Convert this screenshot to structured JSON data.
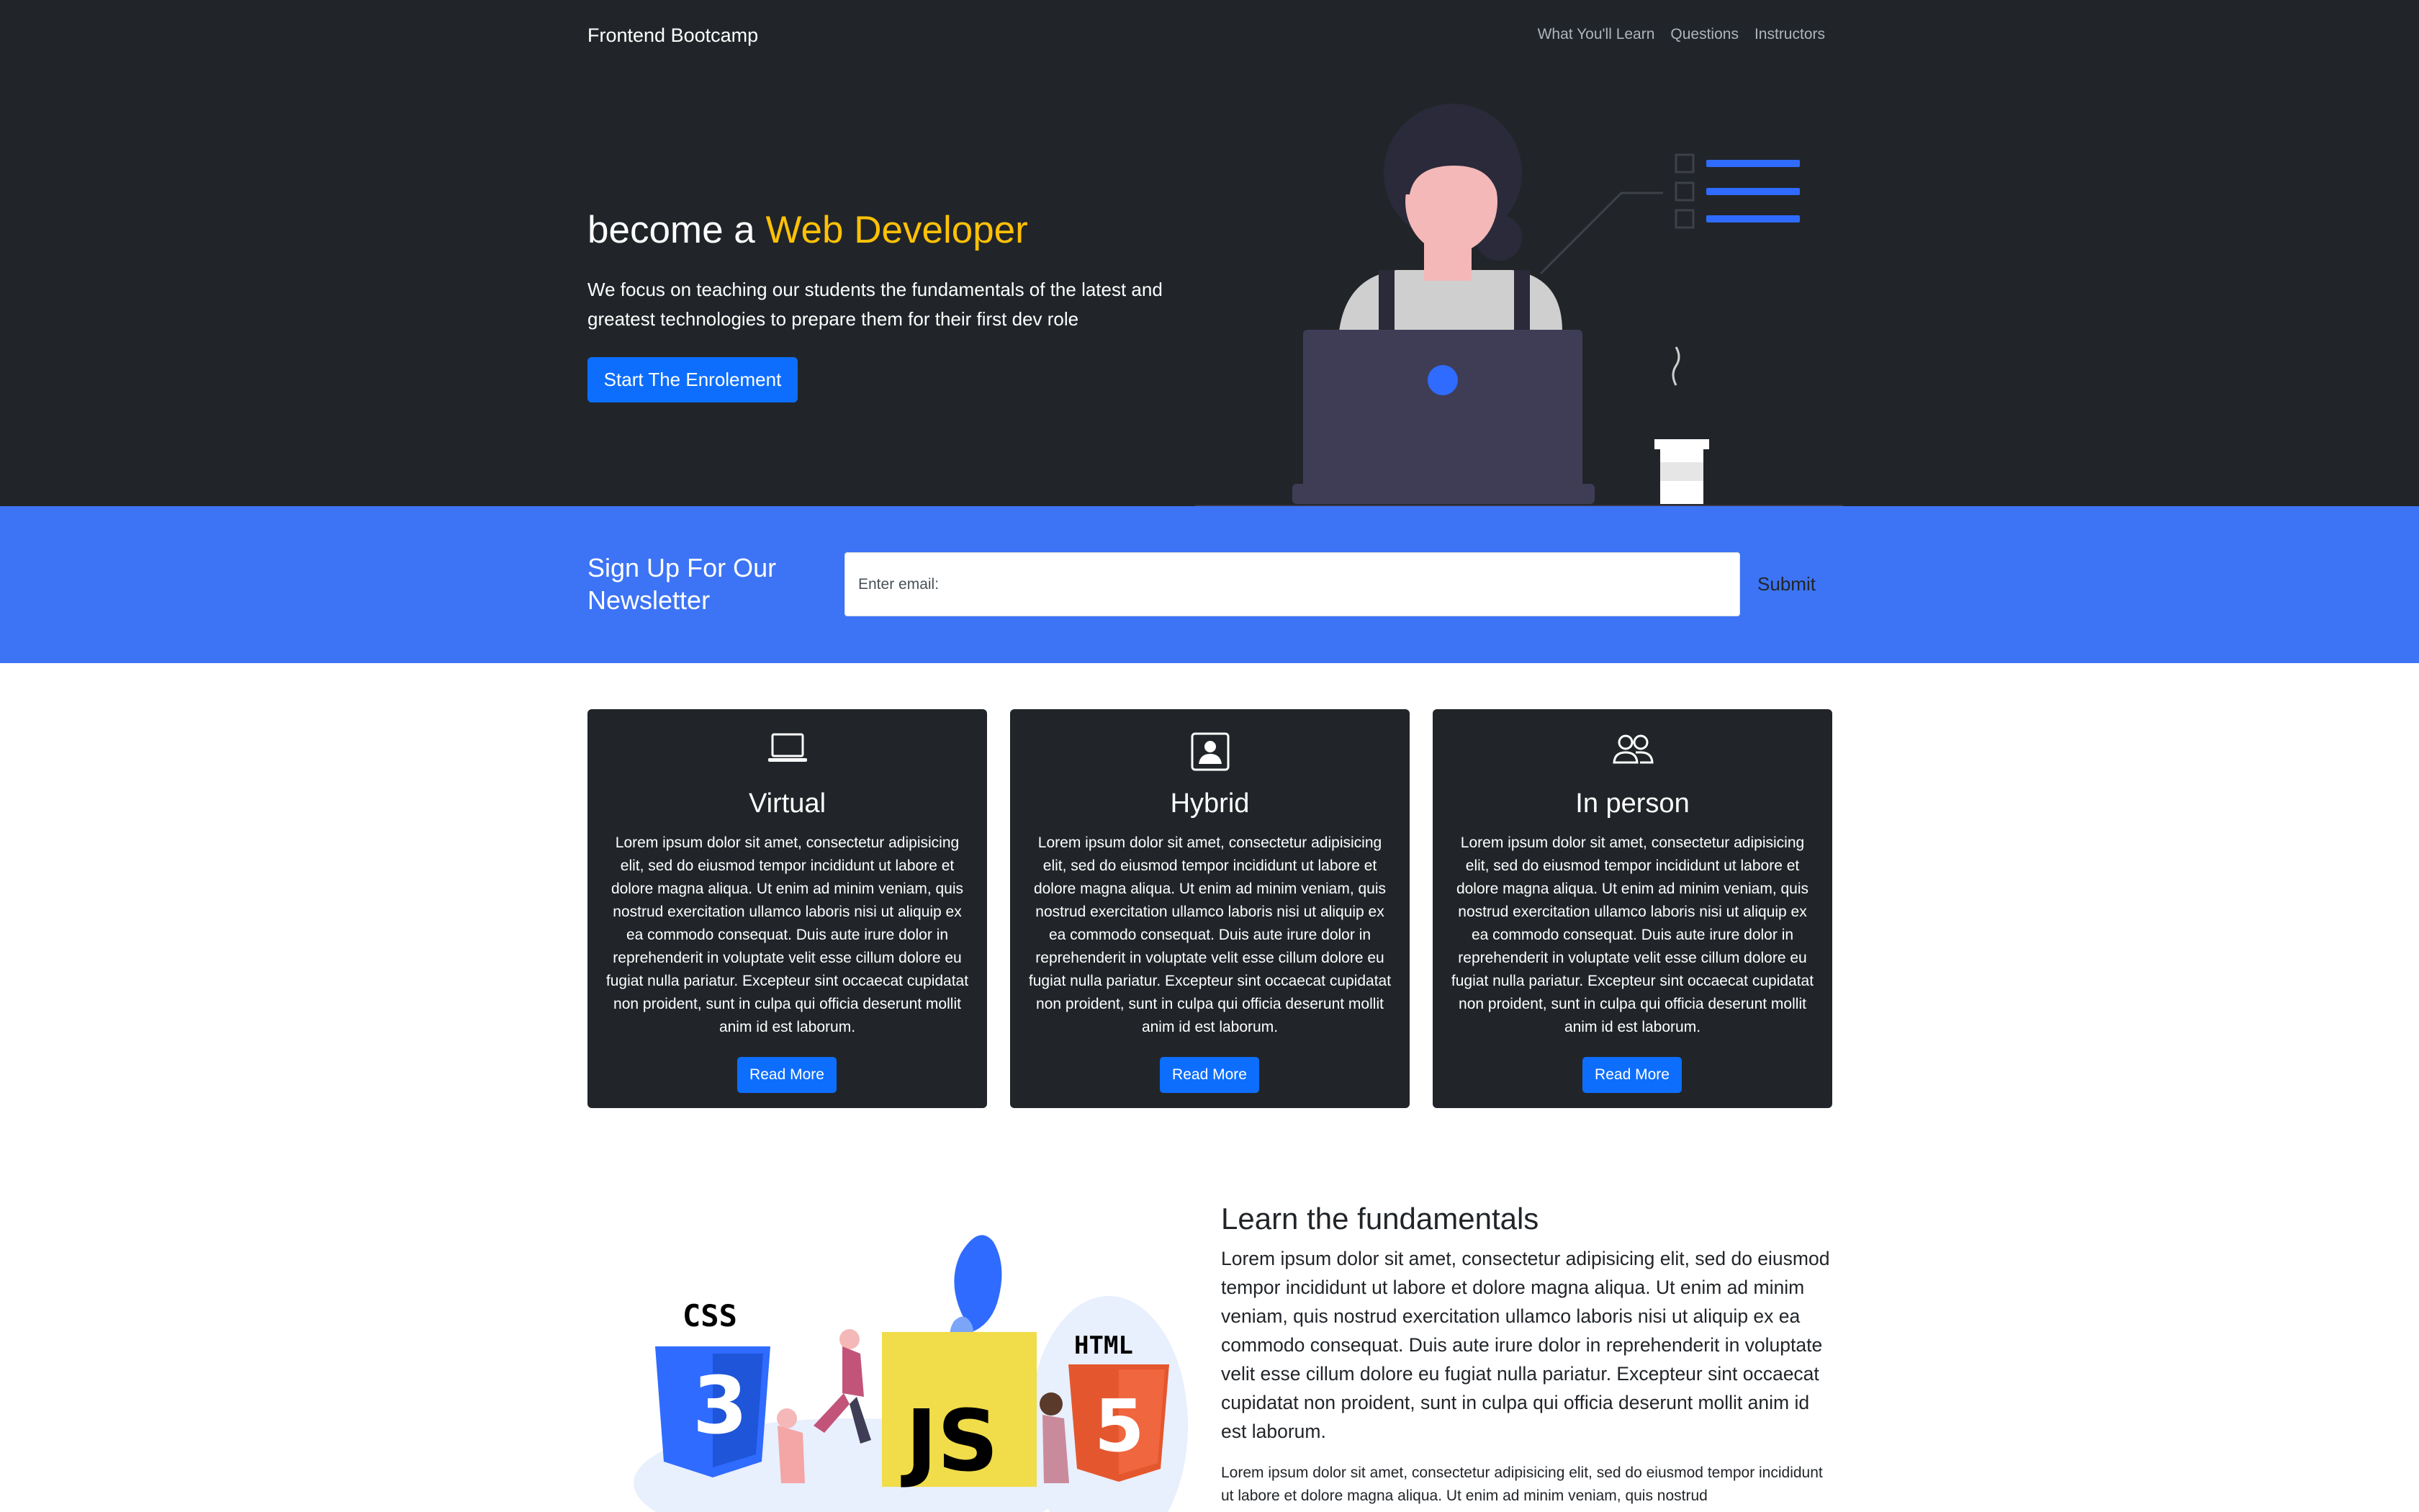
{
  "nav": {
    "brand": "Frontend Bootcamp",
    "links": [
      "What You'll Learn",
      "Questions",
      "Instructors"
    ]
  },
  "hero": {
    "title_prefix": "become a ",
    "title_accent": "Web Developer",
    "lead": "We focus on teaching our students the fundamentals of the latest and greatest technologies to prepare them for their first dev role",
    "button": "Start The Enrolement"
  },
  "newsletter": {
    "title": "Sign Up For Our Newsletter",
    "placeholder": "Enter email:",
    "submit": "Submit"
  },
  "cards": [
    {
      "icon": "laptop-icon",
      "title": "Virtual",
      "text": "Lorem ipsum dolor sit amet, consectetur adipisicing elit, sed do eiusmod tempor incididunt ut labore et dolore magna aliqua. Ut enim ad minim veniam, quis nostrud exercitation ullamco laboris nisi ut aliquip ex ea commodo consequat. Duis aute irure dolor in reprehenderit in voluptate velit esse cillum dolore eu fugiat nulla pariatur. Excepteur sint occaecat cupidatat non proident, sunt in culpa qui officia deserunt mollit anim id est laborum.",
      "button": "Read More"
    },
    {
      "icon": "person-square-icon",
      "title": "Hybrid",
      "text": "Lorem ipsum dolor sit amet, consectetur adipisicing elit, sed do eiusmod tempor incididunt ut labore et dolore magna aliqua. Ut enim ad minim veniam, quis nostrud exercitation ullamco laboris nisi ut aliquip ex ea commodo consequat. Duis aute irure dolor in reprehenderit in voluptate velit esse cillum dolore eu fugiat nulla pariatur. Excepteur sint occaecat cupidatat non proident, sunt in culpa qui officia deserunt mollit anim id est laborum.",
      "button": "Read More"
    },
    {
      "icon": "people-icon",
      "title": "In person",
      "text": "Lorem ipsum dolor sit amet, consectetur adipisicing elit, sed do eiusmod tempor incididunt ut labore et dolore magna aliqua. Ut enim ad minim veniam, quis nostrud exercitation ullamco laboris nisi ut aliquip ex ea commodo consequat. Duis aute irure dolor in reprehenderit in voluptate velit esse cillum dolore eu fugiat nulla pariatur. Excepteur sint occaecat cupidatat non proident, sunt in culpa qui officia deserunt mollit anim id est laborum.",
      "button": "Read More"
    }
  ],
  "fundamentals": {
    "title": "Learn the fundamentals",
    "lead": "Lorem ipsum dolor sit amet, consectetur adipisicing elit, sed do eiusmod tempor incididunt ut labore et dolore magna aliqua. Ut enim ad minim veniam, quis nostrud exercitation ullamco laboris nisi ut aliquip ex ea commodo consequat. Duis aute irure dolor in reprehenderit in voluptate velit esse cillum dolore eu fugiat nulla pariatur. Excepteur sint occaecat cupidatat non proident, sunt in culpa qui officia deserunt mollit anim id est laborum.",
    "text": "Lorem ipsum dolor sit amet, consectetur adipisicing elit, sed do eiusmod tempor incididunt ut labore et dolore magna aliqua. Ut enim ad minim veniam, quis nostrud",
    "logo_css": "CSS",
    "logo_js": "JS",
    "logo_html": "HTML"
  },
  "colors": {
    "dark": "#212529",
    "primary": "#0d6efd",
    "newsletter_bg": "#3d74f5",
    "accent": "#ffc107"
  }
}
